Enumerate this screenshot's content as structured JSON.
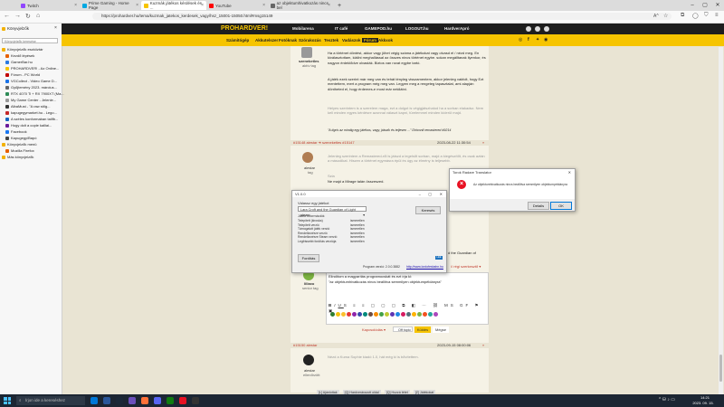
{
  "browser": {
    "tabs": [
      {
        "label": "Twitch",
        "color": "#9146ff"
      },
      {
        "label": "Prime Gaming - Home Page",
        "color": "#00a8e1"
      },
      {
        "label": "Kuzmák játékos kérdések és ...",
        "color": "#f6c400"
      },
      {
        "label": "YouTube",
        "color": "#ff0000"
      },
      {
        "label": "az objektumhivatkozás nincs bel",
        "color": "#666666"
      }
    ],
    "url": "https://prohardver.hu/tema/kuzmak_jatekos_kerdesek_vagy/hsz_15001-15050.html#msg15149",
    "reader_badge": "A^"
  },
  "sidebar": {
    "title": "Könyvjelzők",
    "search_placeholder": "Könyvjelzők keresése",
    "items": [
      {
        "label": "Könyvjelzők eszköztár",
        "color": "#f2b100",
        "indent": 0
      },
      {
        "label": "Kezdő lépések",
        "color": "#e66000",
        "indent": 1
      },
      {
        "label": "GamerBar.hu",
        "color": "#2a7ae2",
        "indent": 1
      },
      {
        "label": "PROHARDVER! - Az Online...",
        "color": "#f6c400",
        "indent": 1
      },
      {
        "label": "Fórum - PC World",
        "color": "#c00000",
        "indent": 1
      },
      {
        "label": "VGCollect - Video Game D...",
        "color": "#1a73e8",
        "indent": 1
      },
      {
        "label": "Gyűjtemény 2023. március...",
        "color": "#666666",
        "indent": 1
      },
      {
        "label": "RTX 4070 Ti + RX 7900XT (Ma...",
        "color": "#2e8b57",
        "indent": 1
      },
      {
        "label": "My Game Center - Jelenle...",
        "color": "#999999",
        "indent": 1
      },
      {
        "label": "AlbaMust - \"A raw stílg...",
        "color": "#333333",
        "indent": 1
      },
      {
        "label": "kapugegymarket.hu - Lego...",
        "color": "#c62828",
        "indent": 1
      },
      {
        "label": "A széles konformaban tailfb...",
        "color": "#1565c0",
        "indent": 1
      },
      {
        "label": "Hogy dolt a copie kalliai...",
        "color": "#6a1b9a",
        "indent": 1
      },
      {
        "label": "Facebook",
        "color": "#1877f2",
        "indent": 1
      },
      {
        "label": "Kapugegy/Bapó",
        "color": "#444444",
        "indent": 1
      },
      {
        "label": "Könyvjelzők menü",
        "color": "#f2b100",
        "indent": 0
      },
      {
        "label": "Mozilla Firefox",
        "color": "#e66000",
        "indent": 1
      },
      {
        "label": "Más könyvjelzők",
        "color": "#f2b100",
        "indent": 0
      }
    ]
  },
  "site": {
    "logo": "PROHARDVER!",
    "header_links": [
      "Mobilarena",
      "IT café",
      "GAMEPOD.hu",
      "LOGOUT.hu",
      "HardverApró"
    ],
    "nav": [
      "Számítógép",
      "Akkutelszer",
      "Fotóknak",
      "Szórakozás",
      "Tesztek",
      "Vadászok",
      "Fórum",
      "Akkxok"
    ]
  },
  "posts": {
    "top_author": "szeneketles",
    "top_rank": "aktív tag",
    "top_paragraphs": [
      "Ha a történet döntést, akkor vagy jöhet végig száma a játékokat vagy olvasd el / nézd meg. En kiválasztottam, kiállni meghallással az összes nincs történet egybe. sokan megálltanak ilyenkor, és nagyon érdeklődve olvasták. Biztos van rovat egybe tartó.",
      "A játék ezek szerint már meg van és tehát tényleg visszamentem, akkor jelenleg vakfolt, hogy Ezt mentettem, mert a program még meg van. Legyen meg a rengeteg tapasztalat, ami alapján döntheted el, hogy érdemes-e most már nekilátni.",
      "Helyes szerintem is a szerelem maga, ezt a dolgot is végigjátszhatod ha a sorban elakadsz. Nem kell minden egyes kérdésre azonnal választ kapni, türelemmel minden kiderül majd.",
      "\"A tigris az mindig egy játékos, vagy, játszik és teljesen ...\" Diriconll remastered #9214"
    ],
    "post2_header": "#15148 alestar ➜ szeneketles #15147",
    "post2_date": "2023-08-22 11:30:54",
    "post2_author": "alestar",
    "post2_rank": "tag",
    "post2_text": "Jelenleg szerintem a Remastered-ről is játszd a legelsőt sorban, majd a kiegészítőt, és csak aztán a másodikat. Hiszen a történet egymásra épül és úgy az élmény is teljesebb.",
    "post2_sub1": "Szia",
    "post2_sub2": "Ne majd a Mirage talán összeszed.",
    "post3_fragment": "d the Guardian of",
    "post3_header_right": "// régi szerkesztő ▾",
    "post3_author": "lillaxo",
    "post3_rank": "senior tag",
    "post3_line1": "Elindítom a magyarítás programocskát és ezt írja ki:",
    "post3_line2": "\"az objektumhivatkozás nincs beállítva semmilyen objektumpéldányra\"",
    "reply_label": "Kapcsolódás ▾",
    "offtopic_label": "Off topic",
    "send_label": "Küldés",
    "cancel_label": "Mégse",
    "post4_header": "#15150 alestar",
    "post4_date": "2023-09-15 08:00:06",
    "post4_author": "alestar",
    "post4_rank": "ellenőrzött",
    "post4_text": "Nézd a Kuma Sophie kiadó 1.0, hát még ki is bővítettem.",
    "bottom_links": [
      "[L] Ajánlottak",
      "[Q] Hardverárazott oldal",
      "[Q] Hozzá tétet",
      "[Z] Játékokat"
    ],
    "tool_icon_colors": [
      "#2e7d32",
      "#f4c20d",
      "#fbc02d",
      "#e53935",
      "#8e24aa",
      "#3949ab",
      "#00897b",
      "#6d4c41",
      "#fb8c00",
      "#43a047",
      "#c0ca33",
      "#5e35b1",
      "#1e88e5",
      "#d81b60",
      "#546e7a",
      "#ffb300",
      "#7cb342",
      "#f4511e",
      "#26a69a",
      "#ab47bc"
    ]
  },
  "magyarito": {
    "title": "V1.0.0",
    "choose_label": "Válassz egy játékot",
    "selected_game": "Lara Croft and the Guardian of Light steam",
    "info_header": "Játék információk",
    "info_rows": [
      {
        "k": "Telepített (kiroska)",
        "v": "ismeretlen"
      },
      {
        "k": "Telepített verzió",
        "v": "ismeretlen"
      },
      {
        "k": "Támogatott játék verzió",
        "v": "ismeretlen"
      },
      {
        "k": "Rendelkezésre verzió",
        "v": "ismeretlen"
      },
      {
        "k": "Rendelkezésre Steam verzió",
        "v": "ismeretlen"
      },
      {
        "k": "Legfrissebb fordítás verziója",
        "v": "ismeretlen"
      }
    ],
    "search_button": "Keresés",
    "install_button": "Fordítás",
    "program_version": "Program verzió: 2.0.0.3882",
    "site_link": "http://www.lordofesbahn.hu",
    "logo_text": "LEE"
  },
  "error_dialog": {
    "title": "Torok Radare Translator",
    "message": "Az objektumhivatkozás nincs beállítva semmilyen objektumpéldányra",
    "details_button": "Details",
    "ok_button": "OK"
  },
  "taskbar": {
    "search_placeholder": "Írjon ide a kereséshez",
    "time": "14:21",
    "date": "2023. 09. 15.",
    "icon_colors": [
      "#0078d7",
      "#2b579a",
      "#1b2838",
      "#6b4fbb",
      "#ff7139",
      "#5865f2",
      "#107c10",
      "#e81123",
      "#333333"
    ]
  }
}
